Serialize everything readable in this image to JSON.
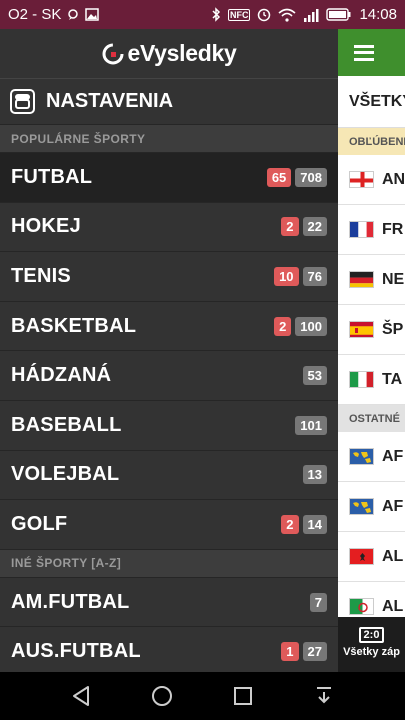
{
  "status_bar": {
    "carrier": "O2 - SK",
    "time": "14:08",
    "icons": [
      "chat-bubble-icon",
      "image-icon",
      "bluetooth-icon",
      "nfc-icon",
      "alarm-icon",
      "wifi-icon",
      "signal-icon",
      "battery-icon"
    ],
    "nfc_label": "NFC"
  },
  "drawer": {
    "brand": "eVysledky",
    "settings_label": "NASTAVENIA",
    "popular_header": "POPULÁRNE ŠPORTY",
    "popular_sports": [
      {
        "label": "FUTBAL",
        "live": "65",
        "total": "708",
        "active": true
      },
      {
        "label": "HOKEJ",
        "live": "2",
        "total": "22"
      },
      {
        "label": "TENIS",
        "live": "10",
        "total": "76"
      },
      {
        "label": "BASKETBAL",
        "live": "2",
        "total": "100"
      },
      {
        "label": "HÁDZANÁ",
        "live": "",
        "total": "53"
      },
      {
        "label": "BASEBALL",
        "live": "",
        "total": "101"
      },
      {
        "label": "VOLEJBAL",
        "live": "",
        "total": "13"
      },
      {
        "label": "GOLF",
        "live": "2",
        "total": "14"
      }
    ],
    "other_header": "INÉ ŠPORTY [A-Z]",
    "other_sports": [
      {
        "label": "AM.FUTBAL",
        "live": "",
        "total": "7"
      },
      {
        "label": "AUS.FUTBAL",
        "live": "1",
        "total": "27"
      }
    ]
  },
  "main": {
    "tab_label": "VŠETKY",
    "favorites_header": "OBĽÚBENÉ",
    "favorites": [
      {
        "name": "AN",
        "flag": "england"
      },
      {
        "name": "FR",
        "flag": "france"
      },
      {
        "name": "NE",
        "flag": "germany"
      },
      {
        "name": "ŠP",
        "flag": "spain"
      },
      {
        "name": "TA",
        "flag": "italy"
      }
    ],
    "others_header": "OSTATNÉ",
    "others": [
      {
        "name": "AF",
        "flag": "world"
      },
      {
        "name": "AF",
        "flag": "world"
      },
      {
        "name": "AL",
        "flag": "albania"
      },
      {
        "name": "AL",
        "flag": "algeria"
      }
    ],
    "bottom_icon_label": "2:0",
    "bottom_label": "Všetky záp"
  },
  "colors": {
    "status_bar": "#6a1e39",
    "drawer_bg": "#333333",
    "live_badge": "#df5a5a",
    "total_badge": "#777777",
    "header_green": "#3f8f2d"
  }
}
